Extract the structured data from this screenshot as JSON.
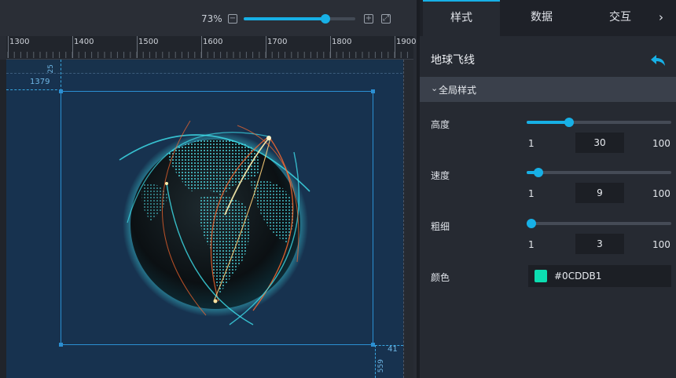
{
  "toolbar": {
    "zoom_label": "73%",
    "zoom_percent": 73,
    "zoom_out_icon": "minus-square-icon",
    "zoom_in_icon": "plus-square-icon",
    "fit_icon": "fit-screen-icon"
  },
  "ruler": {
    "ticks": [
      "1300",
      "1400",
      "1500",
      "1600",
      "1700",
      "1800",
      "1900"
    ]
  },
  "canvas": {
    "left_value": "1379",
    "top_value": "25",
    "right_value": "41",
    "bottom_value": "559"
  },
  "colors": {
    "accent": "#17b0e6",
    "stage_bg": "#17324f",
    "line_cyan": "#3fe3ef",
    "line_orange": "#ff6a2e",
    "swatch": "#0CDDB1"
  },
  "panel": {
    "tabs": [
      {
        "label": "样式",
        "active": true
      },
      {
        "label": "数据",
        "active": false
      },
      {
        "label": "交互",
        "active": false
      }
    ],
    "more_label": "›",
    "title": "地球飞线",
    "back_icon": "undo-arrow-icon",
    "section": {
      "caret": "⌄",
      "title": "全局样式"
    },
    "props": [
      {
        "label": "高度",
        "min": "1",
        "max": "100",
        "value": "30"
      },
      {
        "label": "速度",
        "min": "1",
        "max": "100",
        "value": "9"
      },
      {
        "label": "粗细",
        "min": "1",
        "max": "100",
        "value": "3"
      }
    ],
    "color": {
      "label": "颜色",
      "value": "#0CDDB1"
    }
  }
}
